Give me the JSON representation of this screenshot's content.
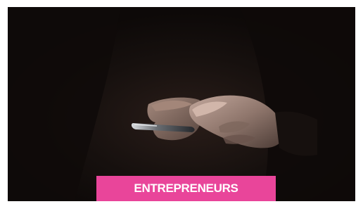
{
  "card": {
    "image_subject": "hands-holding-smartphone-photo",
    "category_label": "ENTREPRENEURS"
  },
  "colors": {
    "badge_background": "#e9459a",
    "badge_text": "#ffffff",
    "image_background": "#120d0c"
  }
}
